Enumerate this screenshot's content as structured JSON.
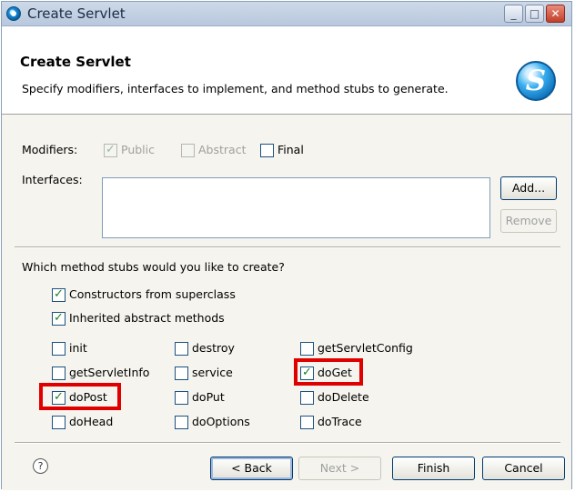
{
  "window": {
    "title": "Create Servlet",
    "controls": {
      "minimize": "_",
      "maximize": "□",
      "close": "✕"
    }
  },
  "banner": {
    "title": "Create Servlet",
    "description": "Specify modifiers, interfaces to implement, and method stubs to generate.",
    "logo_letter": "S"
  },
  "modifiers": {
    "label": "Modifiers:",
    "options": [
      {
        "label": "Public",
        "checked": true,
        "enabled": false
      },
      {
        "label": "Abstract",
        "checked": false,
        "enabled": false
      },
      {
        "label": "Final",
        "checked": false,
        "enabled": true
      }
    ]
  },
  "interfaces": {
    "label": "Interfaces:",
    "add_button": "Add...",
    "remove_button": "Remove",
    "items": []
  },
  "method_stubs": {
    "question": "Which method stubs would you like to create?",
    "constructors": {
      "label": "Constructors from superclass",
      "checked": true
    },
    "inherited_abstract": {
      "label": "Inherited abstract methods",
      "checked": true
    },
    "methods": [
      {
        "label": "init",
        "checked": false
      },
      {
        "label": "destroy",
        "checked": false
      },
      {
        "label": "getServletConfig",
        "checked": false
      },
      {
        "label": "getServletInfo",
        "checked": false
      },
      {
        "label": "service",
        "checked": false
      },
      {
        "label": "doGet",
        "checked": true
      },
      {
        "label": "doPost",
        "checked": true
      },
      {
        "label": "doPut",
        "checked": false
      },
      {
        "label": "doDelete",
        "checked": false
      },
      {
        "label": "doHead",
        "checked": false
      },
      {
        "label": "doOptions",
        "checked": false
      },
      {
        "label": "doTrace",
        "checked": false
      }
    ]
  },
  "footer": {
    "help": "?",
    "back_button": "< Back",
    "next_button": "Next >",
    "finish_button": "Finish",
    "cancel_button": "Cancel"
  },
  "colors": {
    "highlight": "#e00000",
    "check": "#1e7f1e"
  },
  "icons": {
    "window": "servlet-icon",
    "banner": "servlet-logo-icon",
    "help": "help-icon"
  }
}
